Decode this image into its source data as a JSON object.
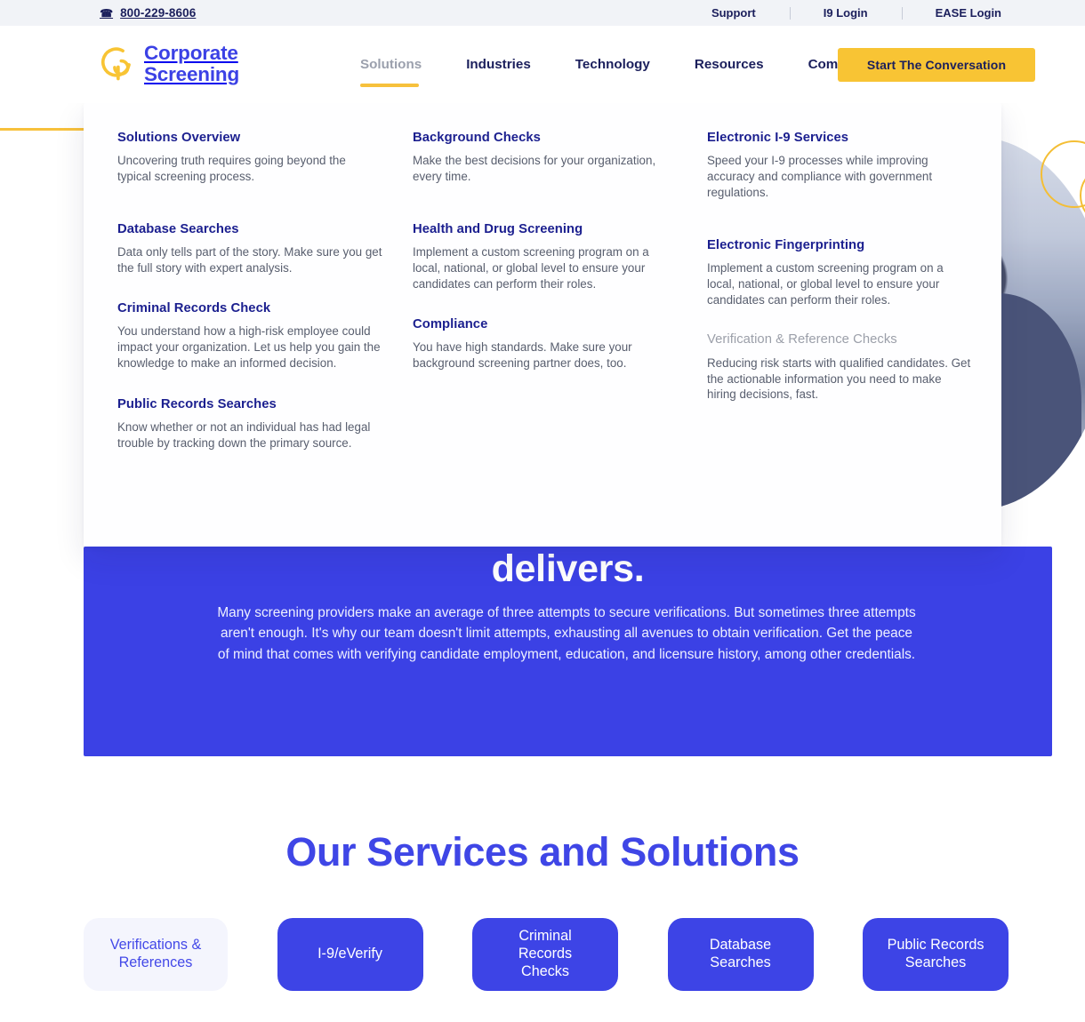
{
  "topbar": {
    "phone": "800-229-8606",
    "phone_icon": "phone-icon",
    "links": [
      {
        "label": "Support"
      },
      {
        "label": "I9 Login"
      },
      {
        "label": "EASE Login"
      }
    ]
  },
  "header": {
    "logo_line1": "Corporate",
    "logo_line2": "Screening",
    "logo_icon": "corporate-screening-logo-icon",
    "nav": [
      {
        "label": "Solutions",
        "active": true
      },
      {
        "label": "Industries",
        "active": false
      },
      {
        "label": "Technology",
        "active": false
      },
      {
        "label": "Resources",
        "active": false
      },
      {
        "label": "Company",
        "active": false
      }
    ],
    "cta_label": "Start The Conversation"
  },
  "hero": {
    "title": "Verification & Reference Checks",
    "body": "Reducing risk starts with qualified candidates. Get the actionable information you need to make hiring decisions, fast.",
    "subheading": "A thorough and efficient process that delivers."
  },
  "mega_menu": {
    "columns": [
      {
        "items": [
          {
            "title": "Solutions Overview",
            "desc": "Uncovering truth requires going beyond the typical screening process.",
            "current": false
          },
          {
            "title": "Database Searches",
            "desc": "Data only tells part of the story. Make sure you get the full story with expert analysis.",
            "current": false
          },
          {
            "title": "Criminal Records Check",
            "desc": "You understand how a high-risk employee could impact your organization. Let us help you gain the knowledge to make an informed decision.",
            "current": false
          },
          {
            "title": "Public Records Searches",
            "desc": "Know whether or not an individual has had legal trouble by tracking down the primary source.",
            "current": false
          }
        ]
      },
      {
        "items": [
          {
            "title": "Background Checks",
            "desc": "Make the best decisions for your organization, every time.",
            "current": false
          },
          {
            "title": "Health and Drug Screening",
            "desc": "Implement a custom screening program on a local, national, or global level to ensure your candidates can perform their roles.",
            "current": false
          },
          {
            "title": "Compliance",
            "desc": "You have high standards. Make sure your background screening partner does, too.",
            "current": false
          }
        ]
      },
      {
        "items": [
          {
            "title": "Electronic I-9 Services",
            "desc": "Speed your I-9 processes while improving accuracy and compliance with government regulations.",
            "current": false
          },
          {
            "title": "Electronic Fingerprinting",
            "desc": "Implement a custom screening program on a local, national, or global level to ensure your candidates can perform their roles.",
            "current": false
          },
          {
            "title": "Verification & Reference Checks",
            "desc": "Reducing risk starts with qualified candidates. Get the actionable information you need to make hiring decisions, fast.",
            "current": true
          }
        ]
      }
    ]
  },
  "blue_band": {
    "heading": "delivers.",
    "paragraph": "Many screening providers make an average of three attempts to secure verifications. But sometimes three attempts aren't enough. It's why our team doesn't limit attempts, exhausting all avenues to obtain verification. Get the peace of mind that comes with verifying candidate employment, education, and licensure history, among other credentials."
  },
  "services": {
    "title": "Our Services and Solutions",
    "pills": [
      {
        "label": "Verifications &\nReferences",
        "active": true
      },
      {
        "label": "I-9/eVerify",
        "active": false
      },
      {
        "label": "Criminal\nRecords\nChecks",
        "active": false
      },
      {
        "label": "Database\nSearches",
        "active": false
      },
      {
        "label": "Public Records\nSearches",
        "active": false
      }
    ]
  },
  "colors": {
    "brand_blue": "#3b41e5",
    "brand_navy": "#1b1f5c",
    "brand_yellow": "#f8c434",
    "topbar_bg": "#f1f3f7",
    "pill_active_bg": "#f4f5fd",
    "muted_text": "#585e6e"
  }
}
